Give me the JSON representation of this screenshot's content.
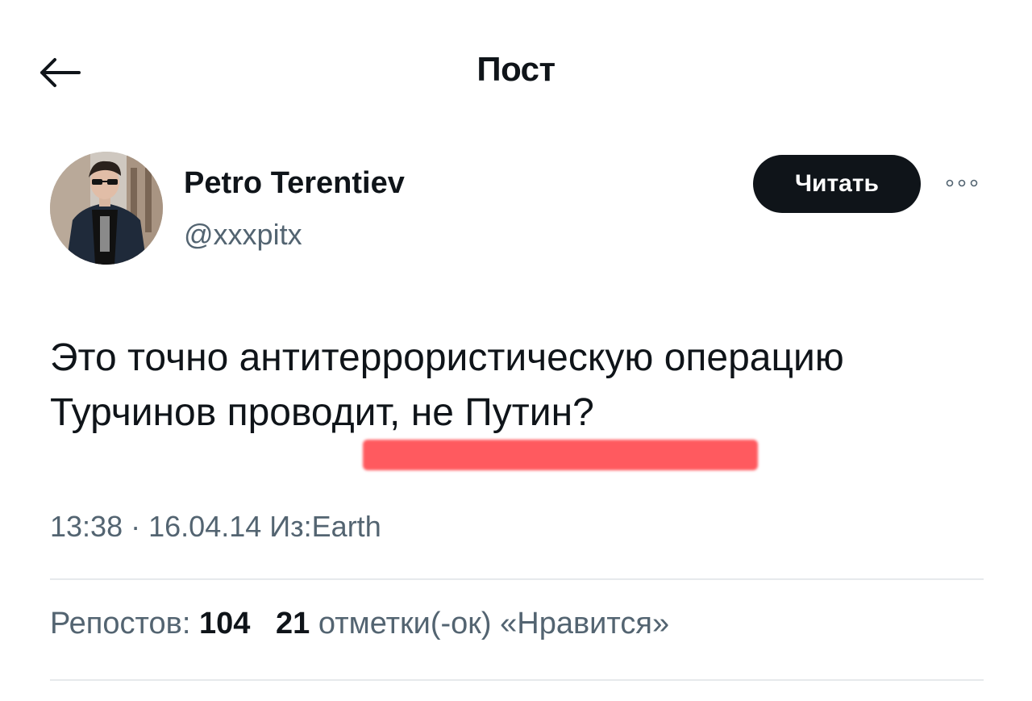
{
  "header": {
    "title": "Пост"
  },
  "author": {
    "name": "Petro Terentiev",
    "handle": "@xxxpitx",
    "follow_label": "Читать"
  },
  "tweet": {
    "line1": "Это точно антитеррористическую операцию",
    "line2": "Турчинов проводит, не Путин?"
  },
  "meta": {
    "time": "13:38",
    "separator": "·",
    "date": "16.04.14",
    "source": "Из:Earth"
  },
  "stats": {
    "reposts_label": "Репостов:",
    "reposts_count": "104",
    "likes_count": "21",
    "likes_label": "отметки(-ок) «Нравится»"
  },
  "icons": {
    "back": "arrow-left-icon",
    "more": "more-dots-icon"
  },
  "colors": {
    "text": "#0f1419",
    "secondary": "#536471",
    "button_bg": "#0f1419",
    "highlight": "#ff5a5f",
    "divider": "#e6e9ec"
  }
}
